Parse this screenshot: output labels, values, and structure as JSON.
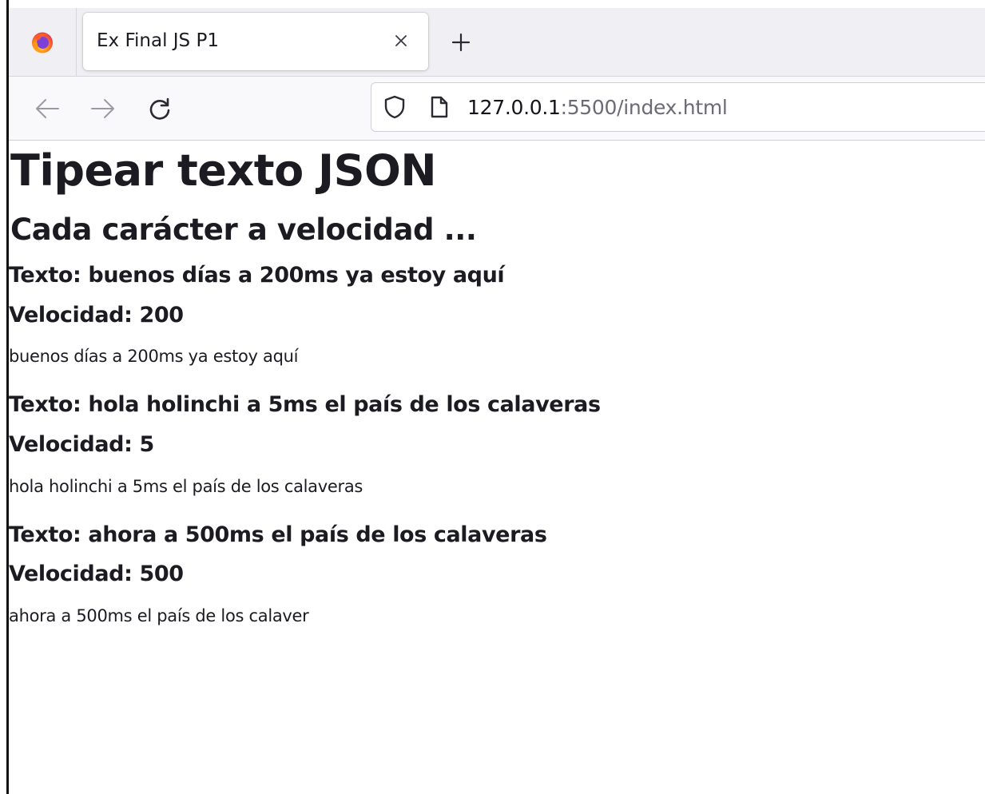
{
  "tab": {
    "title": "Ex Final JS P1"
  },
  "url": {
    "host": "127.0.0.1",
    "path": ":5500/index.html"
  },
  "page": {
    "heading": "Tipear texto JSON",
    "subheading": "Cada carácter a velocidad ...",
    "entries": [
      {
        "texto": "Texto: buenos días a 200ms ya estoy aquí",
        "velocidad": "Velocidad: 200",
        "output": "buenos días a 200ms ya estoy aquí"
      },
      {
        "texto": "Texto: hola holinchi a 5ms el país de los calaveras",
        "velocidad": "Velocidad: 5",
        "output": "hola holinchi a 5ms el país de los calaveras"
      },
      {
        "texto": "Texto: ahora a 500ms el país de los calaveras",
        "velocidad": "Velocidad: 500",
        "output": "ahora a 500ms el país de los calaver"
      }
    ]
  },
  "colors": {
    "tabbar_bg": "#f0f0f4",
    "navbar_bg": "#f9f9fb",
    "text": "#1c1b22",
    "url_path": "#6b6b75"
  },
  "icons": {
    "browser": "firefox-icon",
    "tab_close": "close-icon",
    "new_tab": "plus-icon",
    "back": "arrow-left-icon",
    "forward": "arrow-right-icon",
    "reload": "reload-icon",
    "tracking": "shield-icon",
    "page": "page-icon"
  }
}
